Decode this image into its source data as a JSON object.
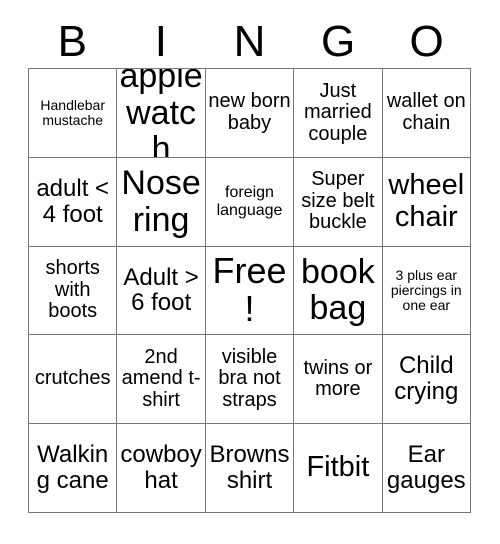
{
  "card": {
    "title_letters": [
      "B",
      "I",
      "N",
      "G",
      "O"
    ],
    "columns": 5,
    "rows": 5,
    "border_color": "#787878",
    "text_color": "#000000",
    "background_color": "#ffffff",
    "cells": [
      [
        {
          "text": "Handlebar mustache",
          "size": "fs-xs"
        },
        {
          "text": "apple watch",
          "size": "fs-xxl"
        },
        {
          "text": "new born baby",
          "size": "fs-m"
        },
        {
          "text": "Just married couple",
          "size": "fs-m"
        },
        {
          "text": "wallet on chain",
          "size": "fs-m"
        }
      ],
      [
        {
          "text": "adult < 4 foot",
          "size": "fs-l"
        },
        {
          "text": "Nose ring",
          "size": "fs-xxl"
        },
        {
          "text": "foreign language",
          "size": "fs-s"
        },
        {
          "text": "Super size belt buckle",
          "size": "fs-m"
        },
        {
          "text": "wheel chair",
          "size": "fs-xl"
        }
      ],
      [
        {
          "text": "shorts with boots",
          "size": "fs-m"
        },
        {
          "text": "Adult > 6 foot",
          "size": "fs-l"
        },
        {
          "text": "Free!",
          "size": "fs-free"
        },
        {
          "text": "book bag",
          "size": "fs-xxl"
        },
        {
          "text": "3 plus ear piercings in one ear",
          "size": "fs-xs"
        }
      ],
      [
        {
          "text": "crutches",
          "size": "fs-m"
        },
        {
          "text": "2nd amend t-shirt",
          "size": "fs-m"
        },
        {
          "text": "visible bra not straps",
          "size": "fs-m"
        },
        {
          "text": "twins or more",
          "size": "fs-m"
        },
        {
          "text": "Child crying",
          "size": "fs-l"
        }
      ],
      [
        {
          "text": "Walking cane",
          "size": "fs-l"
        },
        {
          "text": "cowboy hat",
          "size": "fs-l"
        },
        {
          "text": "Browns shirt",
          "size": "fs-l"
        },
        {
          "text": "Fitbit",
          "size": "fs-xl"
        },
        {
          "text": "Ear gauges",
          "size": "fs-l"
        }
      ]
    ]
  }
}
